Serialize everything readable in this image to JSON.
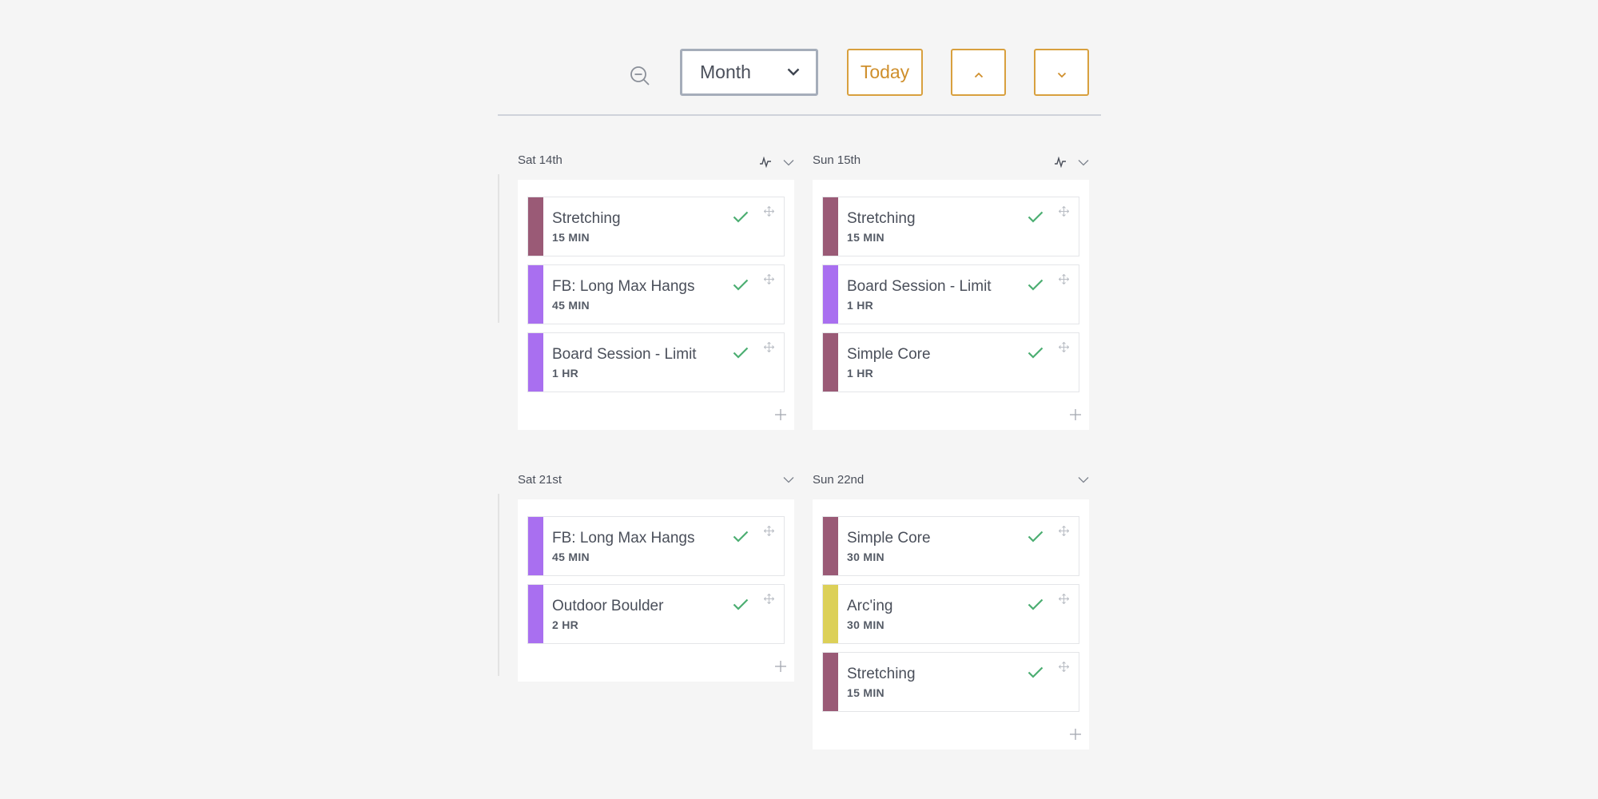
{
  "toolbar": {
    "zoom_icon": "zoom-out-icon",
    "view_select": {
      "value": "Month",
      "options": [
        "Month"
      ]
    },
    "today_label": "Today",
    "prev_icon": "chevron-up-icon",
    "next_icon": "chevron-down-icon"
  },
  "colors": {
    "accent": "#d8a03e",
    "check": "#4cae72",
    "mauve": "#9a5a76",
    "purple": "#a96ff0",
    "yellow": "#dcd058"
  },
  "days": [
    {
      "label": "Sat 14th",
      "has_chart": true,
      "items": [
        {
          "title": "Stretching",
          "duration": "15 MIN",
          "color": "#9a5a76"
        },
        {
          "title": "FB: Long Max Hangs",
          "duration": "45 MIN",
          "color": "#a96ff0"
        },
        {
          "title": "Board Session - Limit",
          "duration": "1 HR",
          "color": "#a96ff0"
        }
      ]
    },
    {
      "label": "Sun 15th",
      "has_chart": true,
      "items": [
        {
          "title": "Stretching",
          "duration": "15 MIN",
          "color": "#9a5a76"
        },
        {
          "title": "Board Session - Limit",
          "duration": "1 HR",
          "color": "#a96ff0"
        },
        {
          "title": "Simple Core",
          "duration": "1 HR",
          "color": "#9a5a76"
        }
      ]
    },
    {
      "label": "Sat 21st",
      "has_chart": false,
      "items": [
        {
          "title": "FB: Long Max Hangs",
          "duration": "45 MIN",
          "color": "#a96ff0"
        },
        {
          "title": "Outdoor Boulder",
          "duration": "2 HR",
          "color": "#a96ff0"
        }
      ]
    },
    {
      "label": "Sun 22nd",
      "has_chart": false,
      "items": [
        {
          "title": "Simple Core",
          "duration": "30 MIN",
          "color": "#9a5a76"
        },
        {
          "title": "Arc'ing",
          "duration": "30 MIN",
          "color": "#dcd058"
        },
        {
          "title": "Stretching",
          "duration": "15 MIN",
          "color": "#9a5a76"
        }
      ]
    }
  ]
}
